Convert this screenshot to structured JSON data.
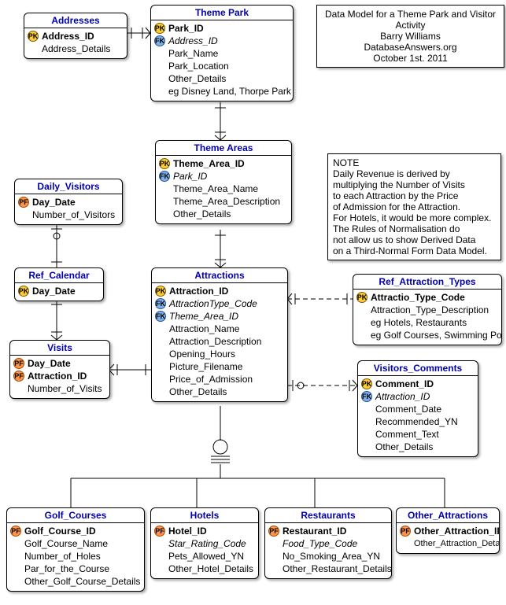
{
  "meta": {
    "line1": "Data Model for a Theme Park and Visitor Activity",
    "line2": "Barry Williams",
    "line3": "DatabaseAnswers.org",
    "line4": "October 1st. 2011"
  },
  "note": {
    "heading": "NOTE",
    "l1": "Daily Revenue is derived by",
    "l2": "multiplying the Number of Visits",
    "l3": "to each Attraction by the Price",
    "l4": "of Admission for the Attraction.",
    "l5": "For Hotels, it would be more complex.",
    "l6": "The Rules of Normalisation do",
    "l7": "not allow us to show Derived Data",
    "l8": "on a Third-Normal Form Data Model."
  },
  "badges": {
    "pk": "PK",
    "fk": "FK",
    "pf": "PF"
  },
  "entities": {
    "addresses": {
      "title": "Addresses",
      "a1": "Address_ID",
      "a2": "Address_Details"
    },
    "themePark": {
      "title": "Theme Park",
      "a1": "Park_ID",
      "a2": "Address_ID",
      "a3": "Park_Name",
      "a4": "Park_Location",
      "a5": "Other_Details",
      "a6": "eg Disney Land, Thorpe Park"
    },
    "themeAreas": {
      "title": "Theme Areas",
      "a1": "Theme_Area_ID",
      "a2": "Park_ID",
      "a3": "Theme_Area_Name",
      "a4": "Theme_Area_Description",
      "a5": "Other_Details"
    },
    "dailyVisitors": {
      "title": "Daily_Visitors",
      "a1": "Day_Date",
      "a2": "Number_of_Visitors"
    },
    "refCalendar": {
      "title": "Ref_Calendar",
      "a1": "Day_Date"
    },
    "visits": {
      "title": "Visits",
      "a1": "Day_Date",
      "a2": "Attraction_ID",
      "a3": "Number_of_Visits"
    },
    "attractions": {
      "title": "Attractions",
      "a1": "Attraction_ID",
      "a2": "AttractionType_Code",
      "a3": "Theme_Area_ID",
      "a4": "Attraction_Name",
      "a5": "Attraction_Description",
      "a6": "Opening_Hours",
      "a7": "Picture_Filename",
      "a8": "Price_of_Admission",
      "a9": "Other_Details"
    },
    "refAttractionTypes": {
      "title": "Ref_Attraction_Types",
      "a1": "Attractio_Type_Code",
      "a2": "Attraction_Type_Description",
      "a3": "eg Hotels, Restaurants",
      "a4": "eg Golf Courses, Swimming Pools"
    },
    "visitorsComments": {
      "title": "Visitors_Comments",
      "a1": "Comment_ID",
      "a2": "Attraction_ID",
      "a3": "Comment_Date",
      "a4": "Recommended_YN",
      "a5": "Comment_Text",
      "a6": "Other_Details"
    },
    "golfCourses": {
      "title": "Golf_Courses",
      "a1": "Golf_Course_ID",
      "a2": "Golf_Course_Name",
      "a3": "Number_of_Holes",
      "a4": "Par_for_the_Course",
      "a5": "Other_Golf_Course_Details"
    },
    "hotels": {
      "title": "Hotels",
      "a1": "Hotel_ID",
      "a2": "Star_Rating_Code",
      "a3": "Pets_Allowed_YN",
      "a4": "Other_Hotel_Details"
    },
    "restaurants": {
      "title": "Restaurants",
      "a1": "Restaurant_ID",
      "a2": "Food_Type_Code",
      "a3": "No_Smoking_Area_YN",
      "a4": "Other_Restaurant_Details"
    },
    "otherAttractions": {
      "title": "Other_Attractions",
      "a1": "Other_Attraction_ID",
      "a2": "Other_Attraction_Details"
    }
  }
}
